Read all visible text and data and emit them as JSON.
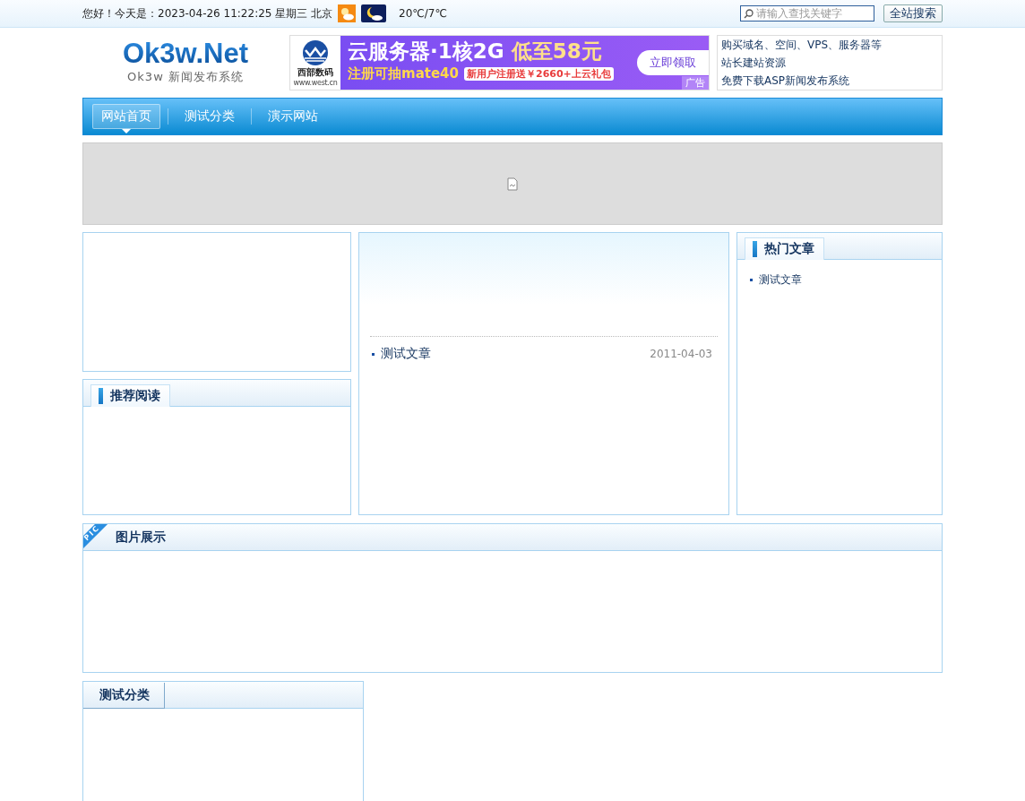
{
  "top_bar": {
    "greeting": "您好！今天是：2023-04-26 11:22:25 星期三 北京",
    "temperature": "20℃/7℃",
    "search": {
      "placeholder": "请输入查找关键字"
    },
    "search_button": "全站搜索"
  },
  "logo": {
    "title": "Ok3w.Net",
    "subtitle": "Ok3w 新闻发布系统"
  },
  "ad_banner": {
    "brand": "西部数码",
    "brand_url": "www.west.cn",
    "headline": "云服务器·1核2G",
    "price": "低至58元",
    "promo": "注册可抽mate40",
    "offer": "新用户注册送￥2660+上云礼包",
    "cta": "立即领取",
    "tag": "广告"
  },
  "header_links": [
    "购买域名、空间、VPS、服务器等",
    "站长建站资源",
    "免费下载ASP新闻发布系统"
  ],
  "nav": [
    {
      "label": "网站首页",
      "selected": true
    },
    {
      "label": "测试分类",
      "selected": false
    },
    {
      "label": "演示网站",
      "selected": false
    }
  ],
  "recommended": {
    "title": "推荐阅读"
  },
  "headlines": {
    "items": [
      {
        "title": "测试文章",
        "date": "2011-04-03"
      }
    ]
  },
  "hot": {
    "title": "热门文章",
    "items": [
      "测试文章"
    ]
  },
  "gallery": {
    "badge": "PIC",
    "title": "图片展示"
  },
  "category": {
    "title": "测试分类"
  }
}
